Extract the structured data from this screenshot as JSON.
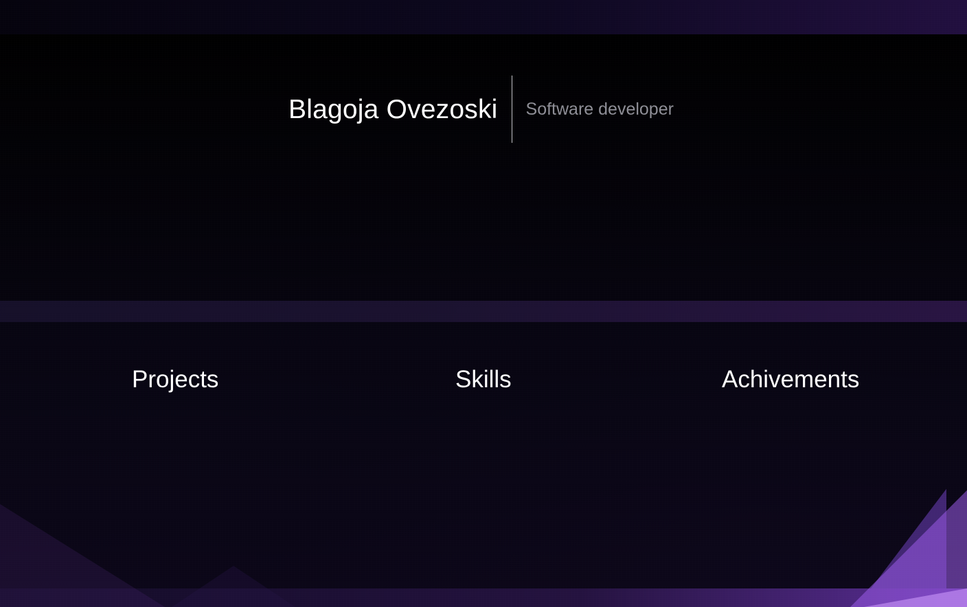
{
  "header": {
    "name": "Blagoja Ovezoski",
    "subtitle": "Software developer"
  },
  "navigation": {
    "items": [
      {
        "label": "Projects"
      },
      {
        "label": "Skills"
      },
      {
        "label": "Achivements"
      }
    ]
  },
  "theme": {
    "background": "#07040f",
    "accent_purple": "#9a5be8",
    "text_primary": "#ffffff",
    "text_secondary": "#8e8e96"
  }
}
